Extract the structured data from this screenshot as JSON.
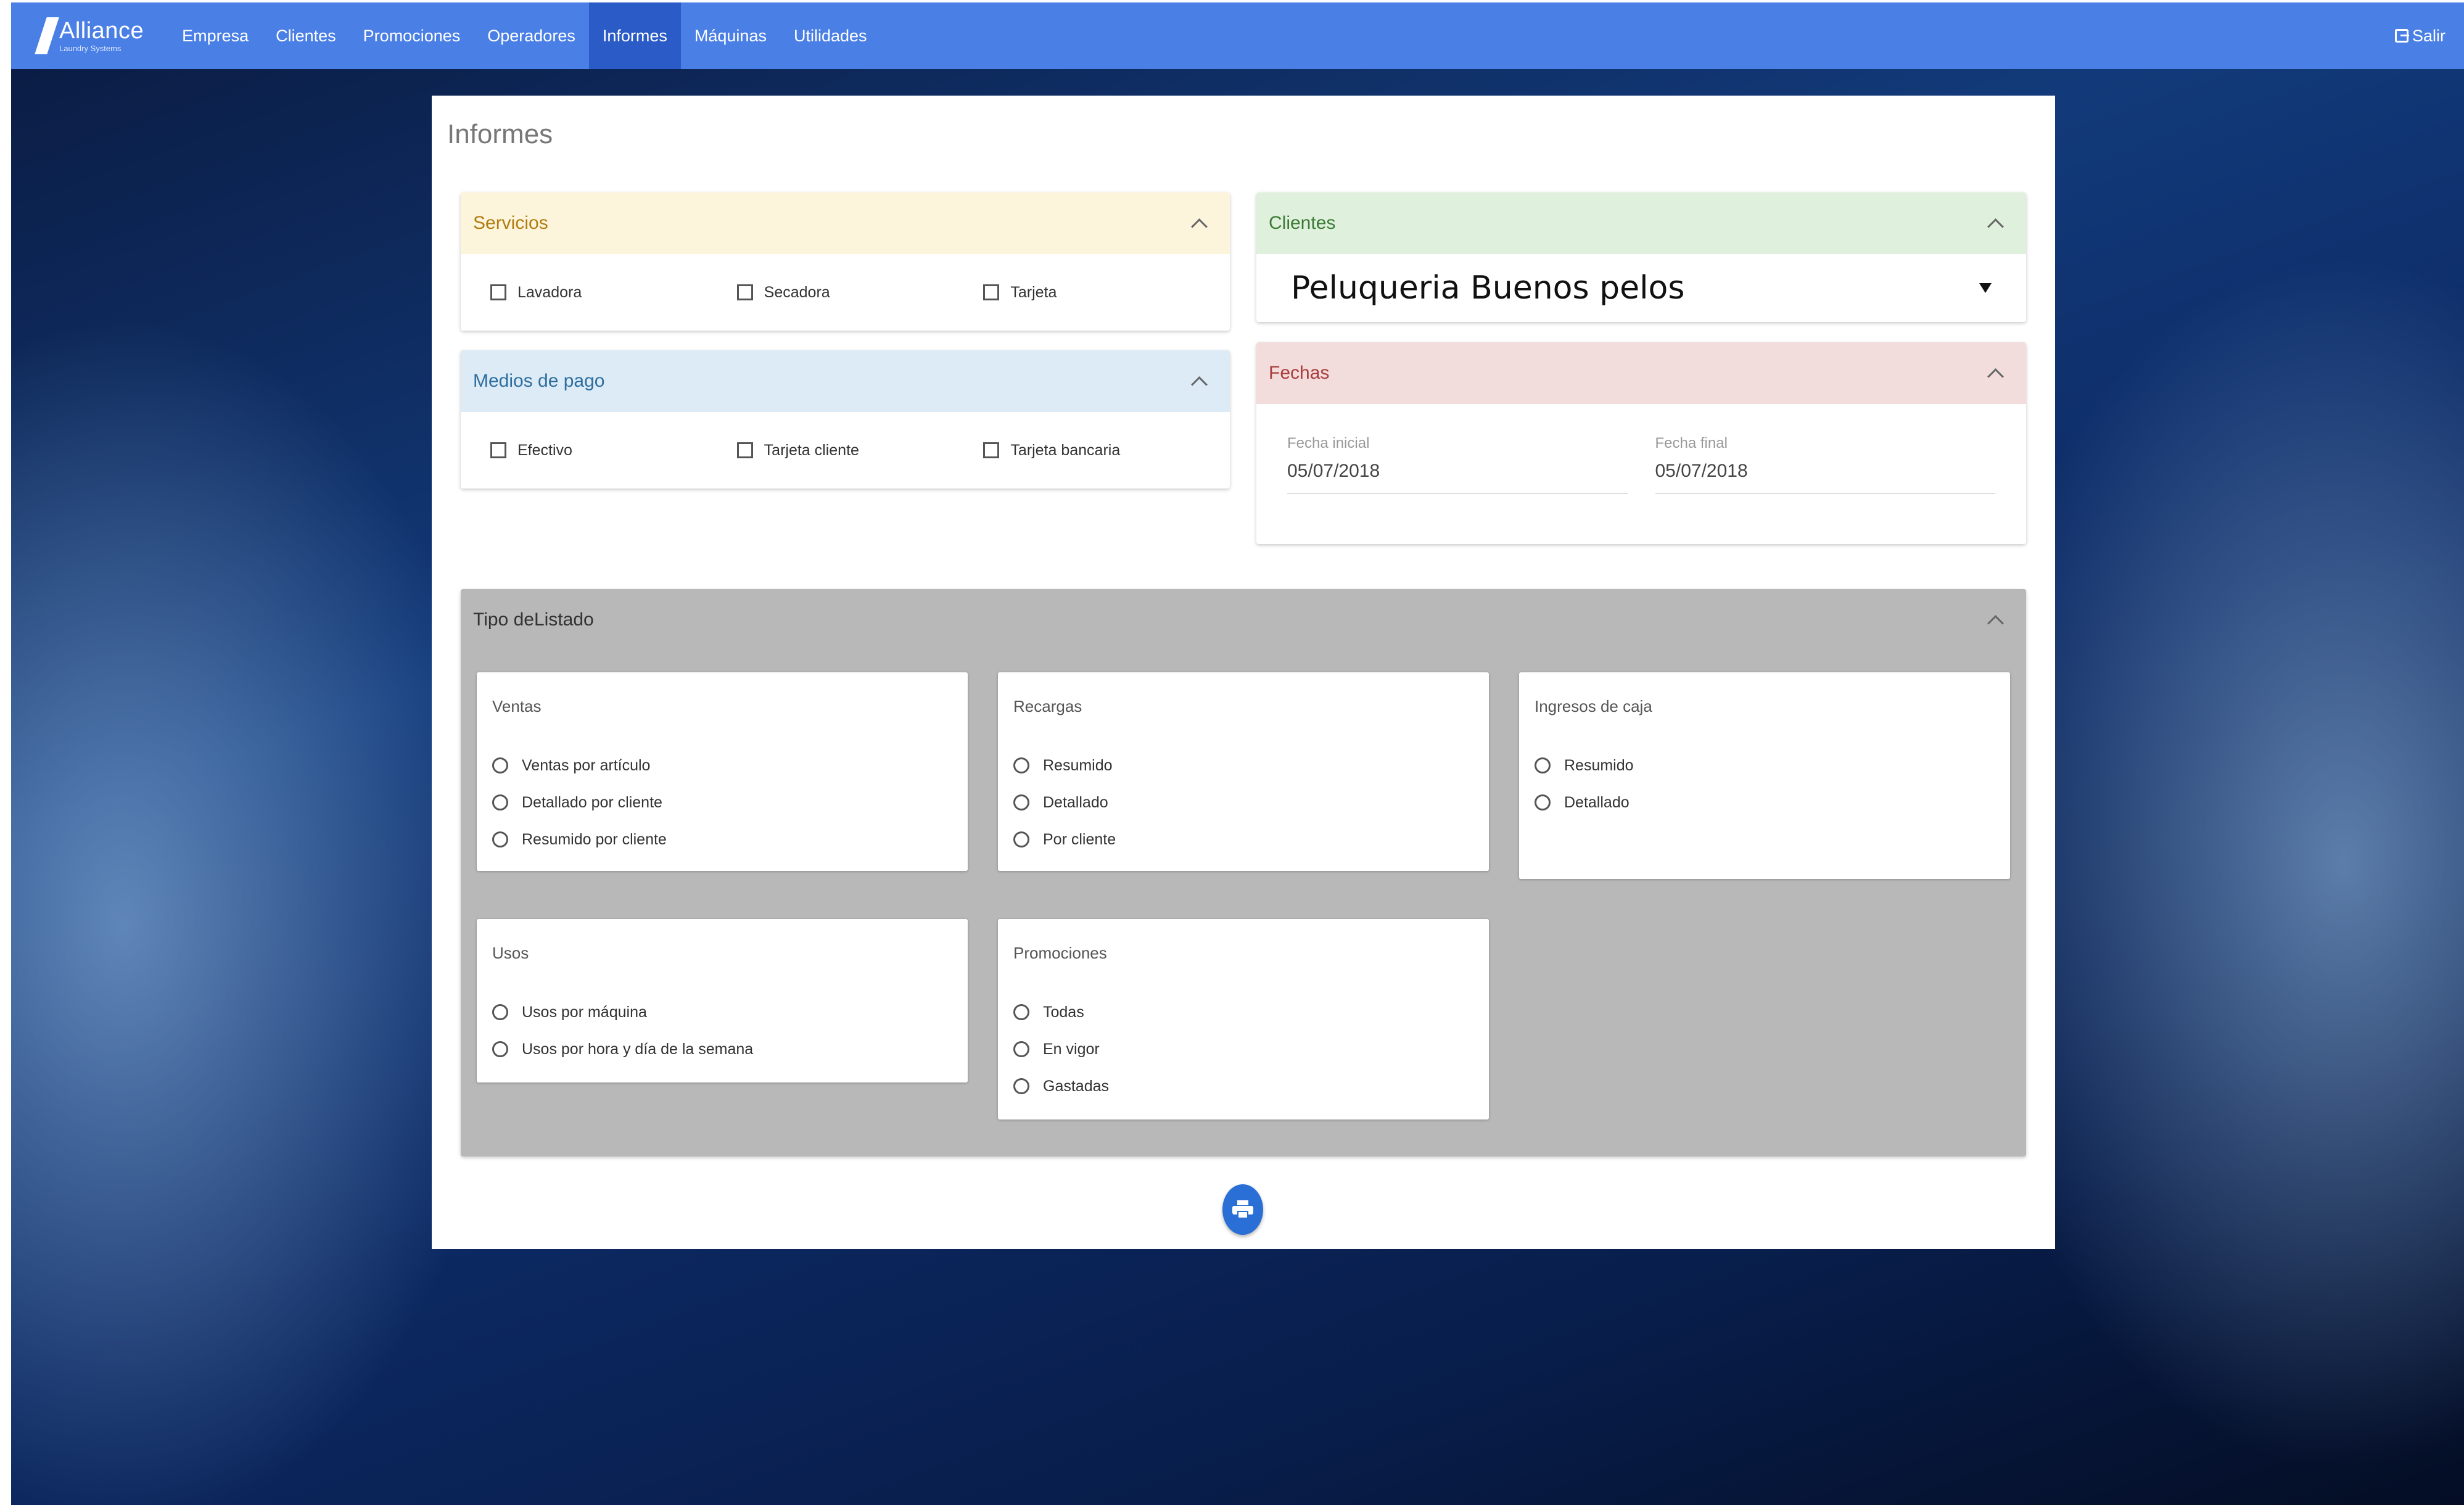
{
  "navbar": {
    "brand": "Alliance",
    "brand_sub": "Laundry Systems",
    "items": [
      {
        "label": "Empresa"
      },
      {
        "label": "Clientes"
      },
      {
        "label": "Promociones"
      },
      {
        "label": "Operadores"
      },
      {
        "label": "Informes",
        "active": true
      },
      {
        "label": "Máquinas"
      },
      {
        "label": "Utilidades"
      }
    ],
    "logout": "Salir",
    "logout_icon": "sign-out-icon",
    "color": "#4a7fe6"
  },
  "page": {
    "title": "Informes"
  },
  "servicios": {
    "title": "Servicios",
    "options": [
      "Lavadora",
      "Secadora",
      "Tarjeta"
    ]
  },
  "medios_pago": {
    "title": "Medios de pago",
    "options": [
      "Efectivo",
      "Tarjeta cliente",
      "Tarjeta bancaria"
    ]
  },
  "clientes": {
    "title": "Clientes",
    "selected": "Peluqueria Buenos pelos"
  },
  "fechas": {
    "title": "Fechas",
    "inicial_label": "Fecha inicial",
    "inicial_value": "05/07/2018",
    "final_label": "Fecha final",
    "final_value": "05/07/2018"
  },
  "tipo_listado": {
    "title": "Tipo deListado",
    "ventas": {
      "title": "Ventas",
      "options": [
        "Ventas por artículo",
        "Detallado por cliente",
        "Resumido por cliente"
      ]
    },
    "recargas": {
      "title": "Recargas",
      "options": [
        "Resumido",
        "Detallado",
        "Por cliente"
      ]
    },
    "ingresos": {
      "title": "Ingresos de caja",
      "options": [
        "Resumido",
        "Detallado"
      ]
    },
    "usos": {
      "title": "Usos",
      "options": [
        "Usos por máquina",
        "Usos por hora y día de la semana"
      ]
    },
    "promociones": {
      "title": "Promociones",
      "options": [
        "Todas",
        "En vigor",
        "Gastadas"
      ]
    }
  },
  "actions": {
    "print_icon": "printer-icon"
  }
}
